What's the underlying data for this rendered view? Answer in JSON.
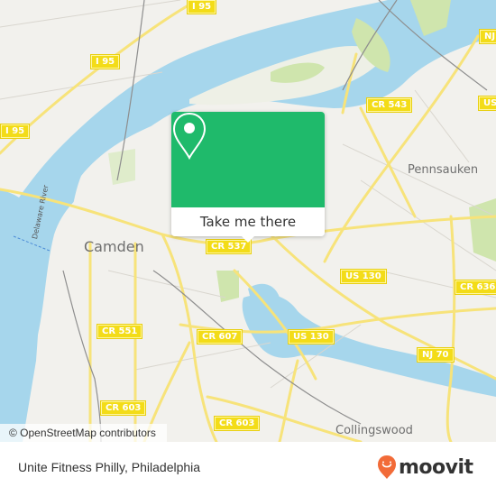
{
  "map": {
    "place_labels": {
      "camden": "Camden",
      "pennsauken": "Pennsauken",
      "collingswood": "Collingswood",
      "delaware_river": "Delaware River"
    },
    "road_shields": {
      "i95_top": "I 95",
      "i95_mid": "I 95",
      "i95_left": "I 95",
      "cr543": "CR 543",
      "cr537": "CR 537",
      "us130_a": "US 130",
      "us130_b": "US 130",
      "cr636": "CR 636",
      "nj70": "NJ 70",
      "cr551": "CR 551",
      "cr607": "CR 607",
      "cr603_a": "CR 603",
      "cr603_b": "CR 603",
      "nj_edge": "NJ",
      "us_edge": "US"
    },
    "colors": {
      "land": "#f2f1ed",
      "water": "#a6d6ec",
      "park": "#cfe5ad",
      "road": "#f7e37a"
    }
  },
  "popup": {
    "icon": "map-pin-icon",
    "button_label": "Take me there",
    "color": "#1fba6b"
  },
  "attribution": "© OpenStreetMap contributors",
  "footer": {
    "location_title": "Unite Fitness Philly, Philadelphia",
    "brand": "moovit",
    "brand_color": "#f26b38"
  }
}
